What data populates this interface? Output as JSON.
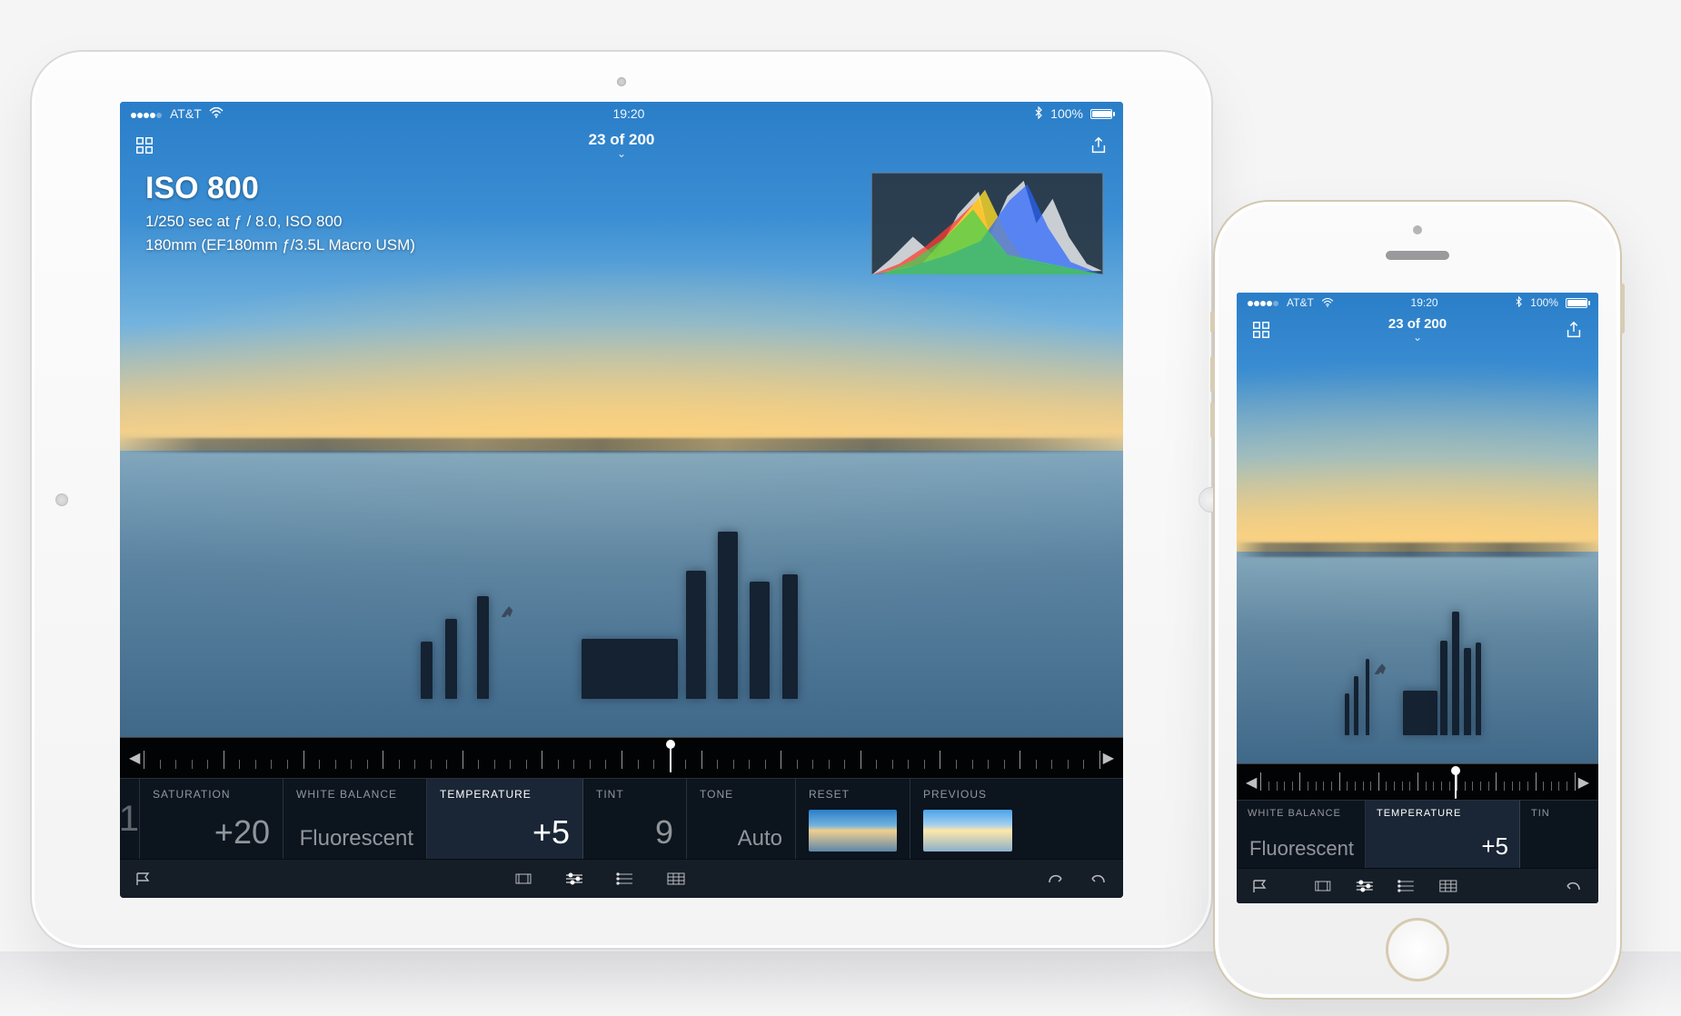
{
  "status": {
    "carrier": "AT&T",
    "time": "19:20",
    "battery": "100%"
  },
  "header": {
    "counter": "23 of 200"
  },
  "meta": {
    "iso": "ISO 800",
    "line1": "1/250 sec at ƒ / 8.0, ISO 800",
    "line2": "180mm (EF180mm ƒ/3.5L Macro USM)"
  },
  "panels": {
    "edge_left_value": "1",
    "saturation": {
      "label": "SATURATION",
      "value": "+20"
    },
    "white_balance": {
      "label": "WHITE BALANCE",
      "value": "Fluorescent"
    },
    "temperature": {
      "label": "TEMPERATURE",
      "value": "+5"
    },
    "tint": {
      "label": "TINT",
      "value": "9"
    },
    "tone": {
      "label": "TONE",
      "value": "Auto"
    },
    "reset": {
      "label": "RESET"
    },
    "previous": {
      "label": "PREVIOUS"
    },
    "tin_partial": {
      "label": "TIN"
    }
  },
  "slider": {
    "indicator_ipad_pct": 55,
    "indicator_iphone_pct": 62
  }
}
